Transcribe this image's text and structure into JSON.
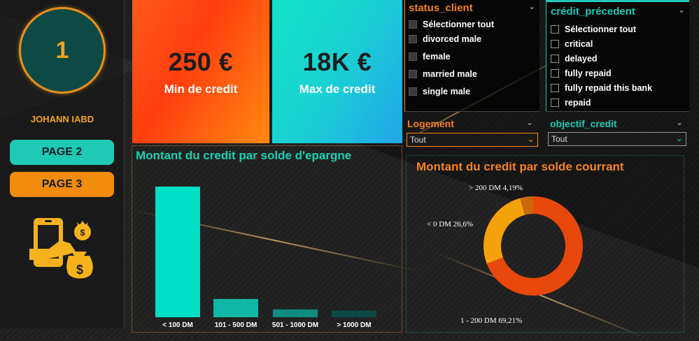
{
  "sidebar": {
    "badge_number": "1",
    "user_name": "JOHANN IABD",
    "buttons": [
      "PAGE 2",
      "PAGE 3"
    ],
    "icon": "phone-money-bag-icon"
  },
  "kpis": [
    {
      "value": "250 €",
      "label": "Min de credit"
    },
    {
      "value": "18K €",
      "label": "Max de credit"
    }
  ],
  "slicers": {
    "status_client": {
      "title": "status_client",
      "options": [
        "Sélectionner tout",
        "divorced male",
        "female",
        "married male",
        "single male"
      ]
    },
    "credit_precedent": {
      "title": "crédit_précedent",
      "options": [
        "Sélectionner tout",
        "critical",
        "delayed",
        "fully repaid",
        "fully repaid this bank",
        "repaid"
      ]
    },
    "logement": {
      "title": "Logement",
      "value": "Tout"
    },
    "objectif_credit": {
      "title": "objectif_credit",
      "value": "Tout"
    }
  },
  "colors": {
    "teal": "#1ec9b5",
    "orange": "#f28c0e",
    "orange_title": "#f5821f",
    "teal_title": "#19d2b4"
  },
  "chart_data": [
    {
      "type": "bar",
      "title": "Montant du credit par solde d'epargne",
      "categories": [
        "< 100 DM",
        "101 - 500 DM",
        "501 - 1000 DM",
        "> 1000 DM"
      ],
      "values": [
        100,
        14,
        6,
        5
      ],
      "xlabel": "",
      "ylabel": "",
      "colors": [
        "#00e0c6",
        "#0fb8a6",
        "#108c80",
        "#0b4a44"
      ]
    },
    {
      "type": "pie",
      "title": "Montant du credit par solde courrant",
      "categories": [
        "1 - 200 DM",
        "< 0 DM",
        "> 200 DM"
      ],
      "values": [
        69.21,
        26.6,
        4.19
      ],
      "labels": [
        "1 - 200 DM 69,21%",
        "< 0 DM 26,6%",
        "> 200 DM 4,19%"
      ],
      "colors": [
        "#e8480c",
        "#f5a10a",
        "#c8690a"
      ]
    }
  ]
}
